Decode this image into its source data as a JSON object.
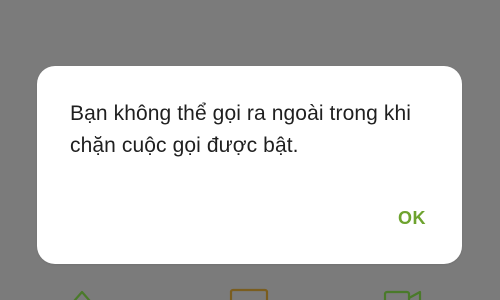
{
  "dialog": {
    "message": "Bạn không thể gọi ra ngoài trong khi chặn cuộc gọi được bật.",
    "ok_label": "OK"
  },
  "colors": {
    "scrim": "#7b7b7b",
    "dialog_background": "#ffffff",
    "message_text": "#1f1f1f",
    "ok_accent": "#6ea32f",
    "bottom_icon_green": "#4a7a2a",
    "bottom_icon_brown": "#7a5d1f"
  },
  "bottom_bar": {
    "icons": [
      "home-icon",
      "square-icon",
      "video-icon"
    ]
  }
}
